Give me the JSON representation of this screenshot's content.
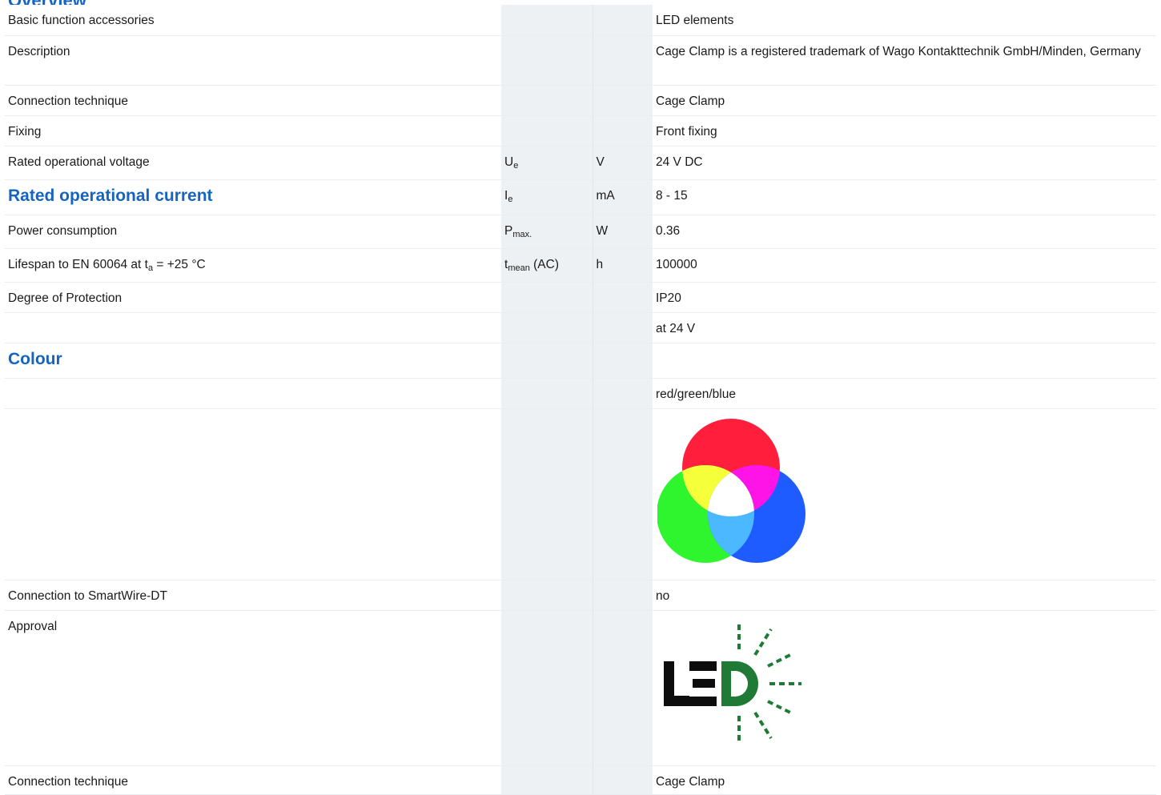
{
  "page": {
    "title": "Overview"
  },
  "rows": {
    "basic": {
      "label": "Basic function accessories",
      "value": "LED elements"
    },
    "description": {
      "label": "Description",
      "value": "Cage Clamp is a registered trademark of Wago Kontakttechnik GmbH/Minden, Germany"
    },
    "connection1": {
      "label": "Connection technique",
      "value": "Cage Clamp"
    },
    "fixing": {
      "label": "Fixing",
      "value": "Front fixing"
    },
    "voltage": {
      "label": "Rated operational voltage",
      "symbol": "U",
      "symbol_sub": "e",
      "unit": "V",
      "value": "24 V DC"
    },
    "current": {
      "label": "Rated operational current",
      "symbol": "I",
      "symbol_sub": "e",
      "unit": "mA",
      "value": "8 - 15"
    },
    "power": {
      "label": "Power consumption",
      "symbol": "P",
      "symbol_sub": "max.",
      "unit": "W",
      "value": "0.36"
    },
    "lifespan": {
      "label_pre": "Lifespan to EN 60064 at t",
      "label_sub": "a",
      "label_post": " = +25 °C",
      "symbol": "t",
      "symbol_sub": "mean",
      "symbol_post": " (AC)",
      "unit": "h",
      "value": "100000"
    },
    "protection": {
      "label": "Degree of Protection",
      "value": "IP20"
    },
    "at24": {
      "value": "at 24 V"
    },
    "colour": {
      "label": "Colour"
    },
    "colour_value": {
      "value": "red/green/blue"
    },
    "smartwire": {
      "label": "Connection to SmartWire-DT",
      "value": "no"
    },
    "approval": {
      "label": "Approval"
    },
    "connection2": {
      "label": "Connection technique",
      "value": "Cage Clamp"
    }
  },
  "icons": {
    "colour_image": "rgb-color-circles-icon",
    "approval_image": "led-logo-icon"
  },
  "colors": {
    "heading": "#1565c0",
    "column_shade": "#eef1f4",
    "led_green": "#1e7a34"
  }
}
